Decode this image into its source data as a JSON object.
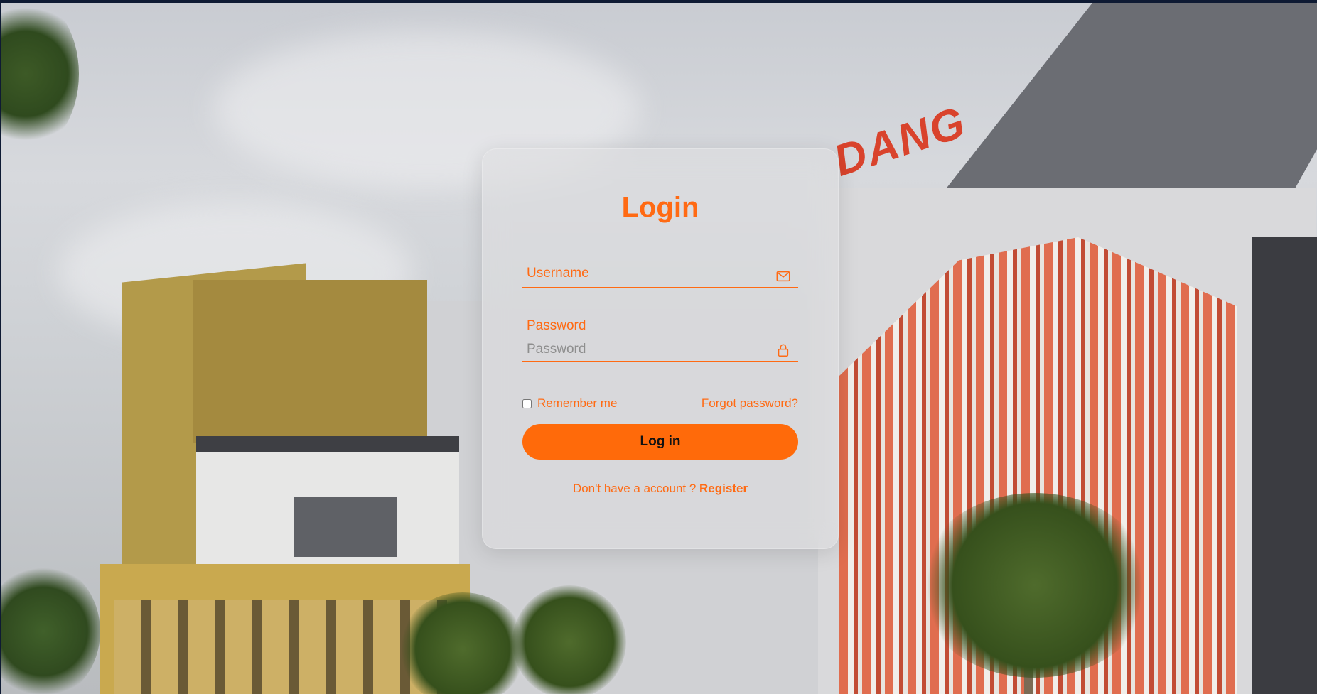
{
  "login": {
    "title": "Login",
    "username_label": "Username",
    "password_label": "Password",
    "password_placeholder": "Password",
    "remember_label": "Remember me",
    "remember_checked": false,
    "forgot_label": "Forgot password?",
    "login_button": "Log in",
    "register_prompt": "Don't have a account ? ",
    "register_link": "Register"
  },
  "background": {
    "sign_text": "DANG"
  },
  "icons": {
    "username": "envelope-icon",
    "password": "lock-icon"
  },
  "colors": {
    "accent": "#ff6a13",
    "button": "#ff6a0a",
    "button_text": "#111111"
  }
}
